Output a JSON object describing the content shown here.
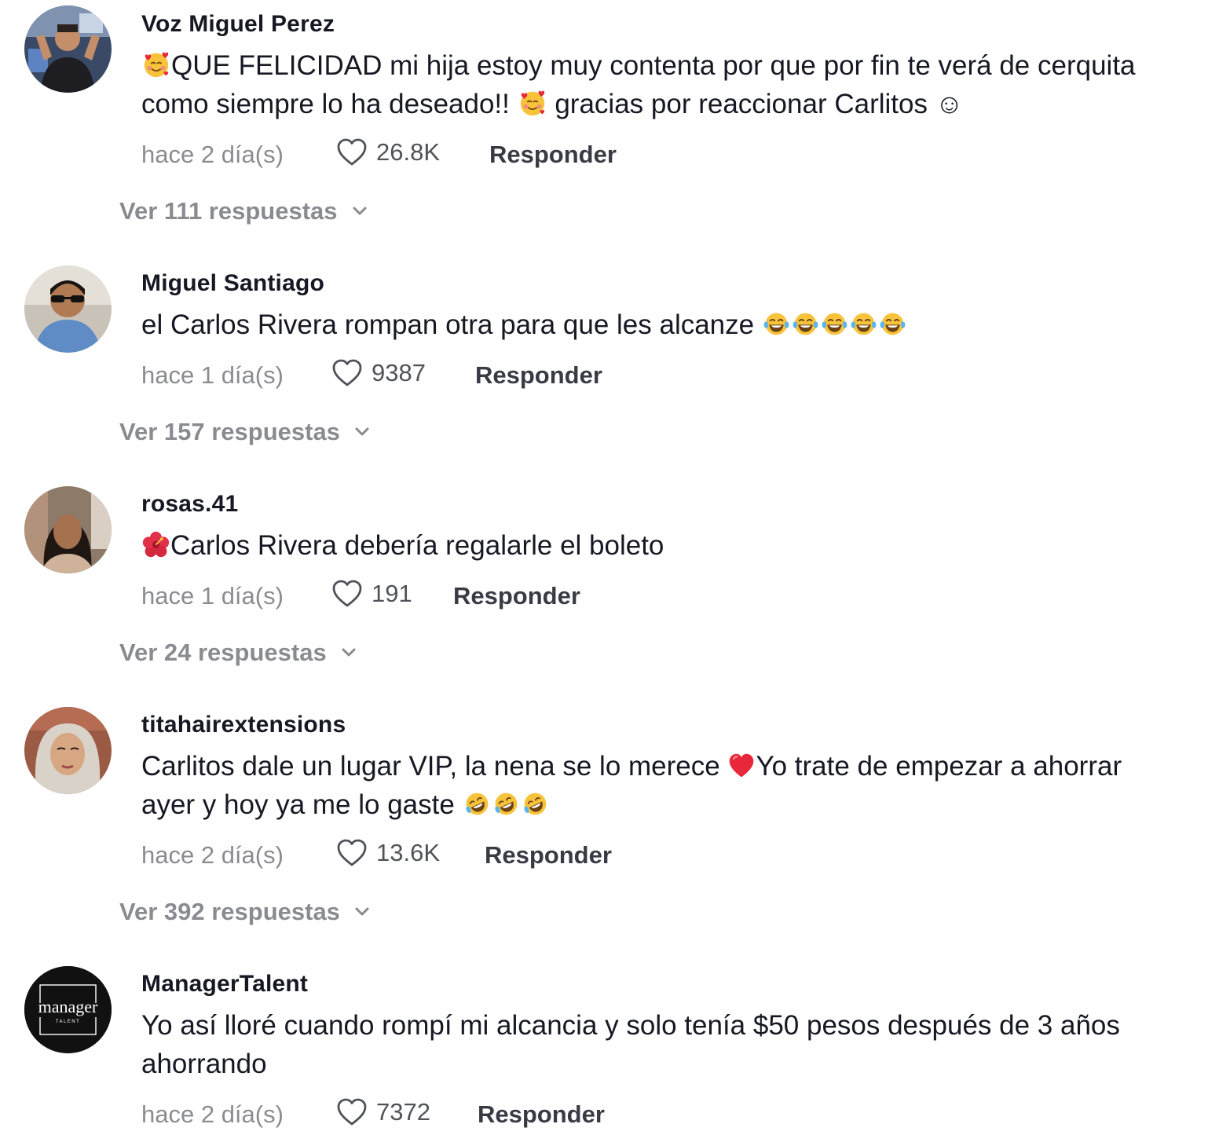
{
  "comments": [
    {
      "username": "Voz Miguel Perez",
      "text_parts": [
        "QUE FELICIDAD mi hija estoy muy contenta por que por fin te verá de cerquita como siempre lo ha deseado!! ",
        " gracias por reaccionar Carlitos ☺"
      ],
      "emoji_icons": [
        "smiling-face-with-hearts-icon",
        "smiling-face-with-hearts-icon"
      ],
      "time": "hace 2 día(s)",
      "likes": "26.8K",
      "reply_label": "Responder",
      "view_replies": "Ver 111 respuestas"
    },
    {
      "username": "Miguel Santiago",
      "text": "el Carlos Rivera rompan otra para que les alcanze ",
      "emoji_icons": [
        "tears-of-joy-icon",
        "tears-of-joy-icon",
        "tears-of-joy-icon",
        "tears-of-joy-icon",
        "tears-of-joy-icon"
      ],
      "time": "hace 1 día(s)",
      "likes": "9387",
      "reply_label": "Responder",
      "view_replies": "Ver 157 respuestas"
    },
    {
      "username": "rosas.41",
      "text": "Carlos Rivera debería regalarle el boleto",
      "emoji_icons": [
        "hibiscus-icon"
      ],
      "time": "hace 1 día(s)",
      "likes": "191",
      "reply_label": "Responder",
      "view_replies": "Ver 24 respuestas"
    },
    {
      "username": "titahairextensions",
      "text_parts": [
        "Carlitos dale un lugar VIP, la nena se lo merece ",
        "Yo trate de empezar a ahorrar ayer y hoy ya me lo gaste "
      ],
      "emoji_icons": [
        "red-heart-icon",
        "rolling-laughing-icon",
        "rolling-laughing-icon",
        "rolling-laughing-icon"
      ],
      "time": "hace 2 día(s)",
      "likes": "13.6K",
      "reply_label": "Responder",
      "view_replies": "Ver 392 respuestas"
    },
    {
      "username": "ManagerTalent",
      "text": "Yo así lloré cuando rompí mi alcancia y solo tenía $50 pesos después de 3 años ahorrando",
      "avatar_logo_text": "manager",
      "avatar_logo_sub": "TALENT",
      "time": "hace 2 día(s)",
      "likes": "7372",
      "reply_label": "Responder"
    }
  ],
  "colors": {
    "text": "#161823",
    "muted": "#8a8b91"
  }
}
